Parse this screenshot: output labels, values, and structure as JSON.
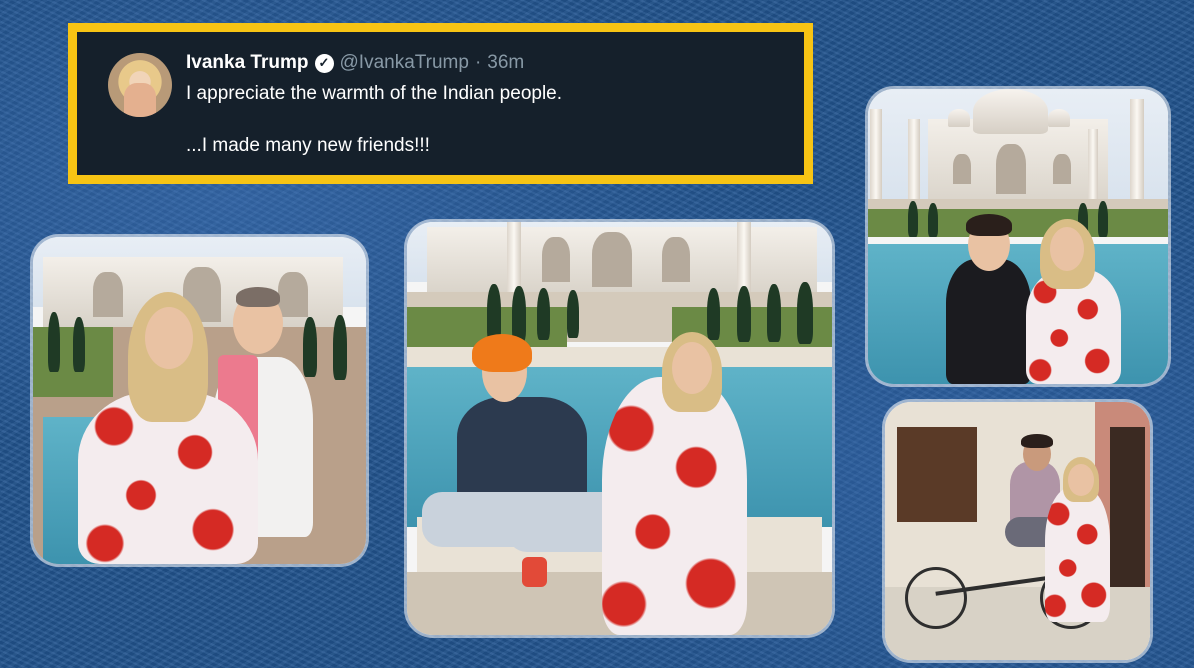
{
  "tweet": {
    "name": "Ivanka Trump",
    "handle": "@IvankaTrump",
    "separator": "·",
    "time": "36m",
    "line1": "I appreciate the warmth of the Indian people.",
    "line2": "...I made many new friends!!!"
  },
  "colors": {
    "frame": "#f7c414",
    "tweet_bg": "#15202b",
    "background": "#22548f"
  }
}
